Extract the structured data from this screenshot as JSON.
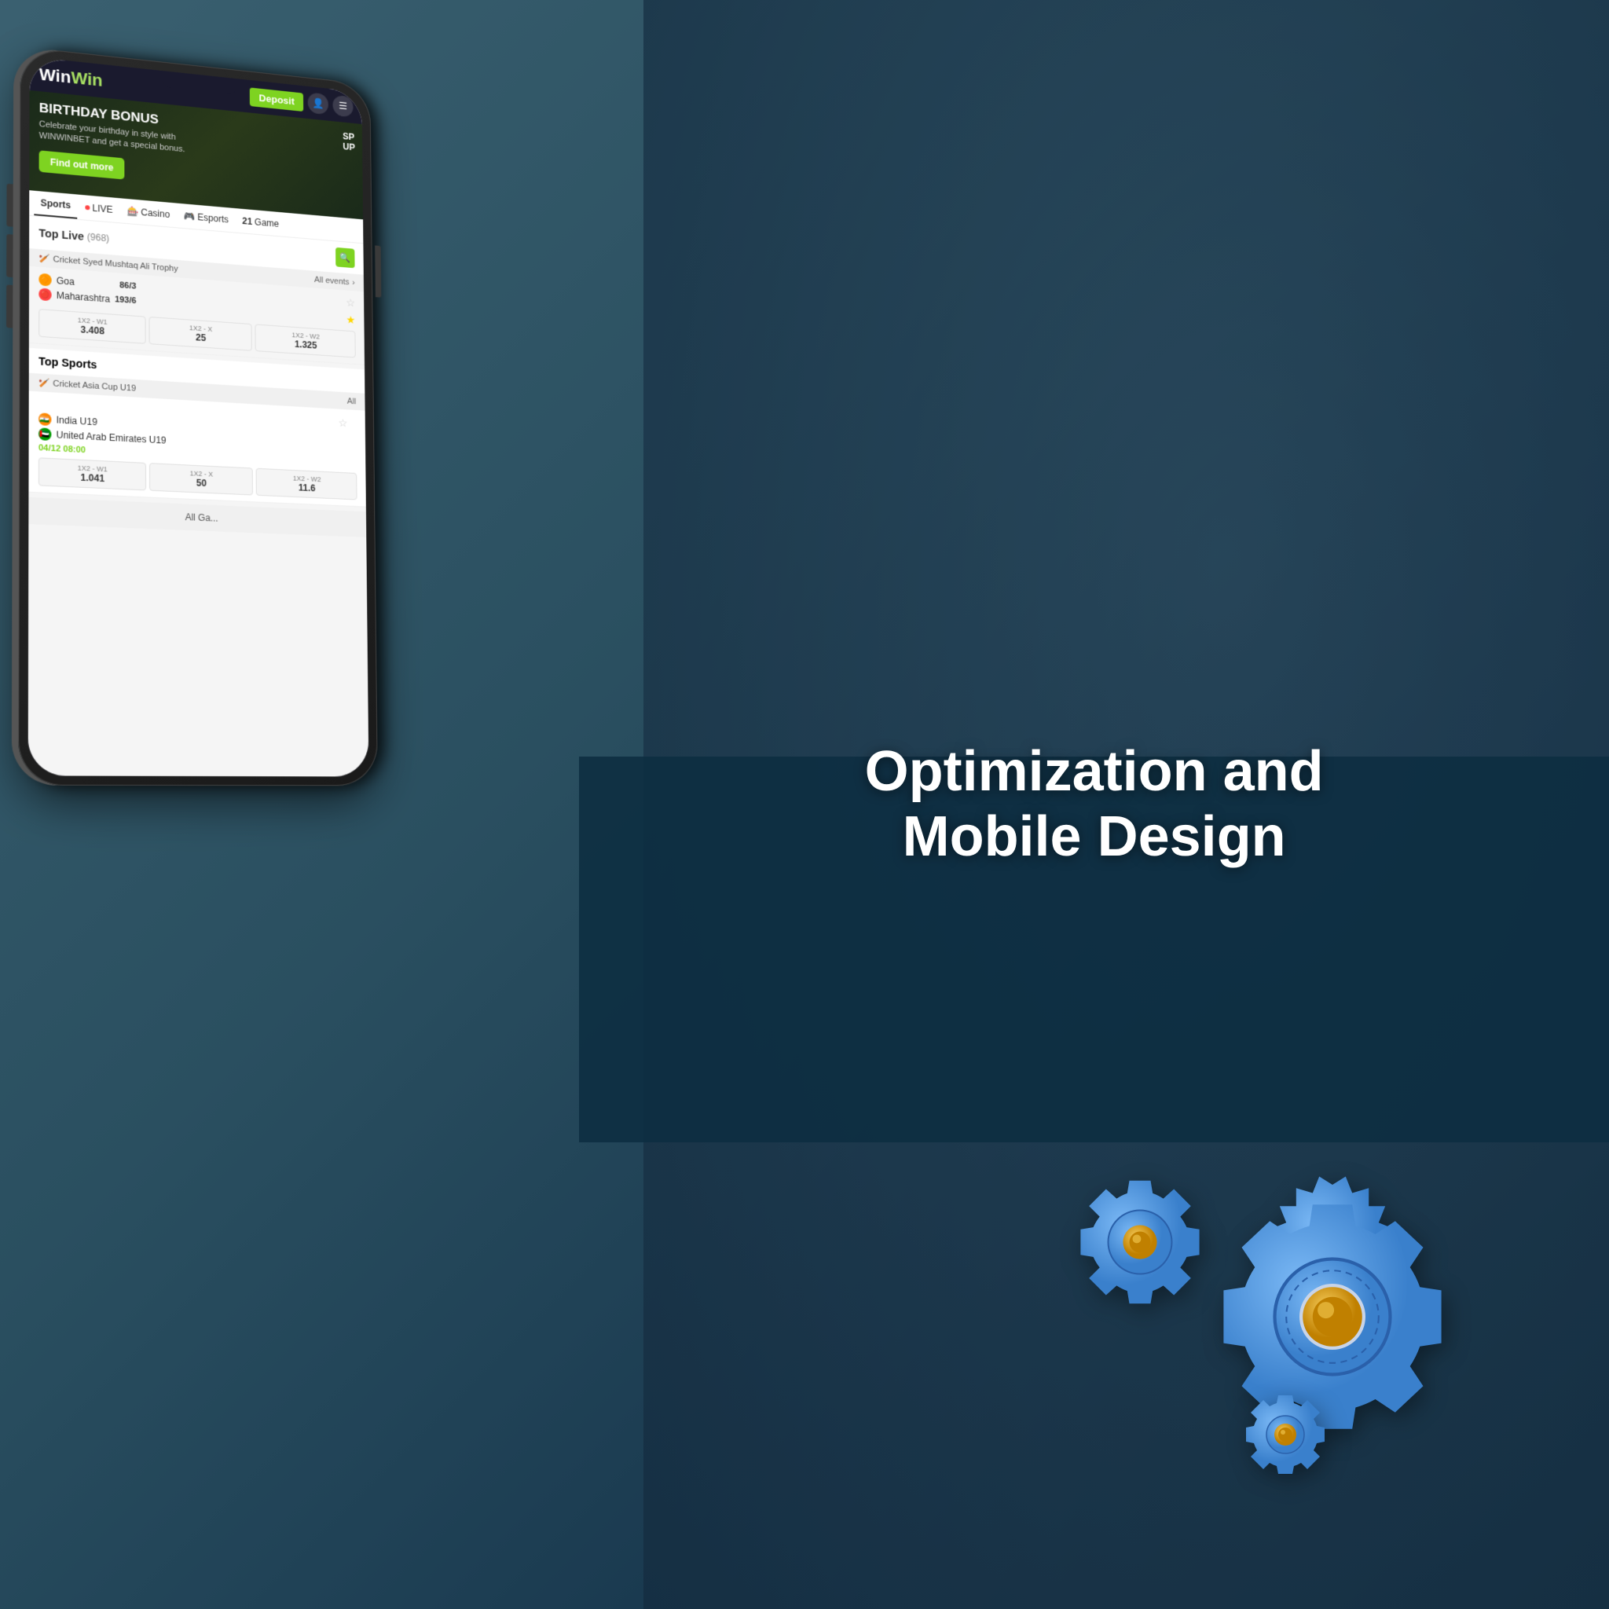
{
  "background": {
    "color": "#3a6070"
  },
  "banner": {
    "text_line1": "Optimization and",
    "text_line2": "Mobile Design"
  },
  "phone": {
    "header": {
      "logo": "WinWin",
      "logo_part1": "Win",
      "logo_part2": "Win",
      "deposit_label": "Deposit"
    },
    "hero": {
      "title": "BIRTHDAY BONUS",
      "subtitle": "Celebrate your birthday in style with WINWINBET and get a special bonus.",
      "cta": "Find out more",
      "side_text_line1": "SP",
      "side_text_line2": "UP"
    },
    "nav_tabs": [
      {
        "label": "Sports",
        "active": true
      },
      {
        "label": "LIVE",
        "has_dot": true
      },
      {
        "label": "Casino",
        "icon": "🎰"
      },
      {
        "label": "Esports",
        "icon": "🎮"
      },
      {
        "label": "Game",
        "number": "21"
      }
    ],
    "top_live": {
      "title": "Top Live",
      "count": "(968)",
      "category": "Cricket Syed Mushtaq Ali Trophy",
      "all_events": "All events",
      "match": {
        "team1": "Goa",
        "team2": "Maharashtra",
        "score1": "86/3",
        "score2": "193/6"
      },
      "odds": [
        {
          "label": "1X2 - W1",
          "value": "3.408"
        },
        {
          "label": "1X2 - X",
          "value": "25"
        },
        {
          "label": "1X2 - W2",
          "value": "1.325"
        }
      ]
    },
    "top_sports": {
      "title": "Top Sports",
      "category": "Cricket Asia Cup U19",
      "all_label": "All",
      "match": {
        "team1": "India U19",
        "team2": "United Arab Emirates U19",
        "time": "04/12 08:00"
      },
      "odds": [
        {
          "label": "1X2 - W1",
          "value": "1.041"
        },
        {
          "label": "1X2 - X",
          "value": "50"
        },
        {
          "label": "1X2 - W2",
          "value": "11.6"
        }
      ]
    },
    "bottom": {
      "label": "All Ga..."
    }
  },
  "gears": {
    "large_color": "#4a90d9",
    "medium_color": "#5ba0e0",
    "small_color": "#5ba0e0",
    "hub_color": "#f0c040",
    "center_color": "#d0d8e8"
  }
}
